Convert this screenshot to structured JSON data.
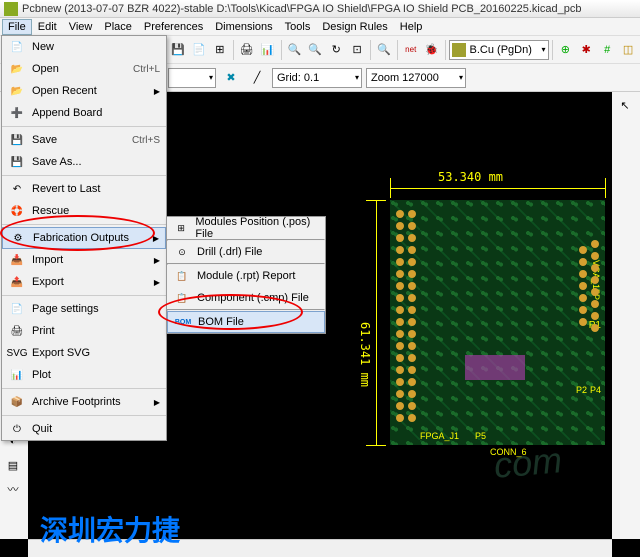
{
  "title": "Pcbnew (2013-07-07 BZR 4022)-stable D:\\Tools\\Kicad\\FPGA IO Shield\\FPGA IO Shield PCB_20160225.kicad_pcb",
  "menubar": [
    "File",
    "Edit",
    "View",
    "Place",
    "Preferences",
    "Dimensions",
    "Tools",
    "Design Rules",
    "Help"
  ],
  "toolbar2": {
    "track_w": "",
    "grid": "Grid: 0.1",
    "zoom": "Zoom 127000"
  },
  "layer": "B.Cu (PgDn)",
  "file_menu": [
    {
      "icon": "📄",
      "label": "New"
    },
    {
      "icon": "📂",
      "label": "Open",
      "shortcut": "Ctrl+L"
    },
    {
      "icon": "📂",
      "label": "Open Recent",
      "arrow": true
    },
    {
      "icon": "➕",
      "label": "Append Board"
    },
    "sep",
    {
      "icon": "💾",
      "label": "Save",
      "shortcut": "Ctrl+S"
    },
    {
      "icon": "💾",
      "label": "Save As..."
    },
    "sep",
    {
      "icon": "↶",
      "label": "Revert to Last"
    },
    {
      "icon": "🛟",
      "label": "Rescue"
    },
    "sep",
    {
      "icon": "⚙",
      "label": "Fabrication Outputs",
      "arrow": true,
      "hi": true
    },
    {
      "icon": "📥",
      "label": "Import",
      "arrow": true
    },
    {
      "icon": "📤",
      "label": "Export",
      "arrow": true
    },
    "sep",
    {
      "icon": "📄",
      "label": "Page settings"
    },
    {
      "icon": "🖨",
      "label": "Print"
    },
    {
      "icon": "SVG",
      "label": "Export SVG"
    },
    {
      "icon": "📊",
      "label": "Plot"
    },
    "sep",
    {
      "icon": "📦",
      "label": "Archive Footprints",
      "arrow": true
    },
    "sep",
    {
      "icon": "⏻",
      "label": "Quit"
    }
  ],
  "fab_submenu": [
    {
      "icon": "⊞",
      "label": "Modules Position (.pos) File"
    },
    "sep",
    {
      "icon": "⊙",
      "label": "Drill (.drl) File"
    },
    "sep",
    {
      "icon": "📋",
      "label": "Module (.rpt) Report"
    },
    {
      "icon": "📋",
      "label": "Component (.cmp) File"
    },
    "sep",
    {
      "icon": "BOM",
      "label": "BOM File",
      "hi": true
    }
  ],
  "dims": {
    "w": "53.340  mm",
    "h": "61.341  mm"
  },
  "pcb_labels": {
    "p1": "P1",
    "vga": "VGA_15P",
    "fpga": "FPGA_J1",
    "p5": "P5",
    "conn": "CONN_6",
    "p4": "P4",
    "p2": "P2"
  },
  "watermark": "深圳宏力捷",
  "wm2": "com"
}
